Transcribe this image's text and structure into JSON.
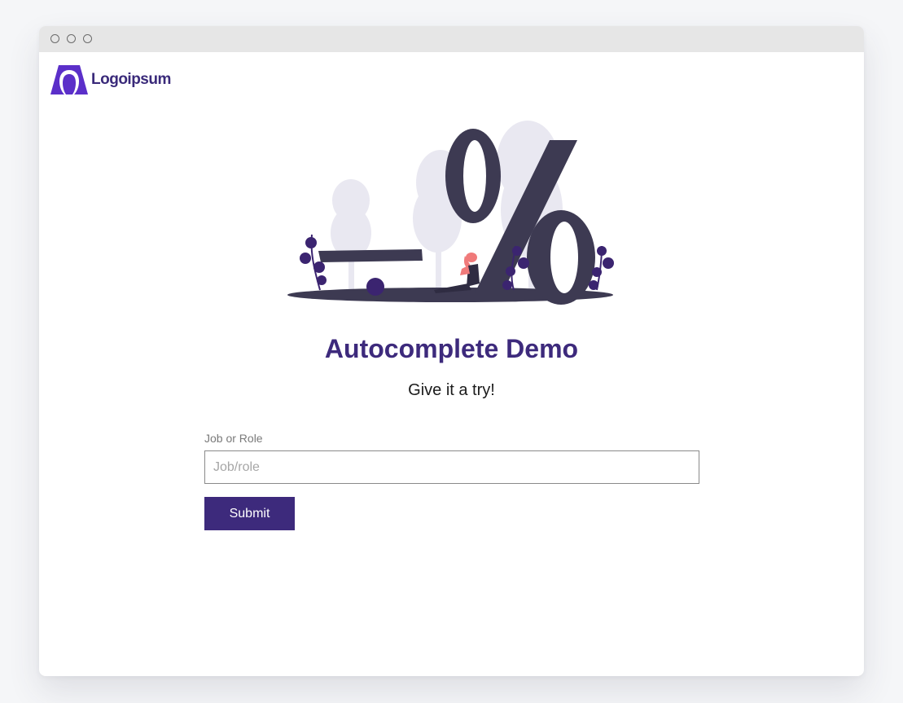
{
  "window": {
    "controls": [
      "close",
      "minimize",
      "maximize"
    ]
  },
  "brand": {
    "name": "Logoipsum",
    "icon": "logoipsum-icon",
    "color": "#3a2a7a"
  },
  "hero": {
    "icon": "discount-percent-illustration"
  },
  "main": {
    "title": "Autocomplete Demo",
    "subtitle": "Give it a try!"
  },
  "form": {
    "job_label": "Job or Role",
    "job_placeholder": "Job/role",
    "job_value": "",
    "submit_label": "Submit"
  },
  "colors": {
    "accent": "#3d2a7c",
    "page_background": "#f5f6f8",
    "titlebar": "#e6e6e6"
  }
}
